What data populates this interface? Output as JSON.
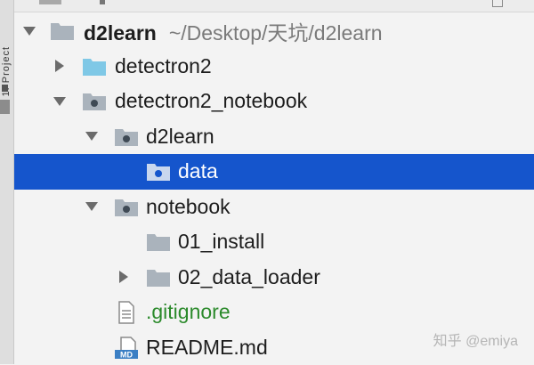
{
  "side_strip": {
    "label": "1: Project"
  },
  "tree": {
    "root": {
      "name": "d2learn",
      "path": "~/Desktop/天坑/d2learn",
      "expanded": true,
      "icon": "folder-icon"
    },
    "items": [
      {
        "name": "detectron2",
        "type": "folder",
        "expanded": false,
        "icon": "folder-cyan-icon"
      },
      {
        "name": "detectron2_notebook",
        "type": "package",
        "expanded": true,
        "icon": "package-folder-icon"
      },
      {
        "name": "d2learn",
        "type": "package",
        "expanded": true,
        "icon": "package-folder-icon"
      },
      {
        "name": "data",
        "type": "package",
        "selected": true,
        "icon": "package-folder-icon"
      },
      {
        "name": "notebook",
        "type": "package",
        "expanded": true,
        "icon": "package-folder-icon"
      },
      {
        "name": "01_install",
        "type": "folder",
        "icon": "folder-icon"
      },
      {
        "name": "02_data_loader",
        "type": "folder",
        "expanded": false,
        "icon": "folder-icon"
      },
      {
        "name": ".gitignore",
        "type": "file",
        "icon": "text-file-icon",
        "color": "#2b8a2b"
      },
      {
        "name": "README.md",
        "type": "file",
        "icon": "markdown-file-icon",
        "badge": "MD"
      }
    ]
  },
  "watermark": "知乎 @emiya",
  "colors": {
    "selection": "#1555cc",
    "folder": "#aab3bc",
    "folder_cyan": "#7fc8e6",
    "ignored_text": "#2b8a2b"
  }
}
